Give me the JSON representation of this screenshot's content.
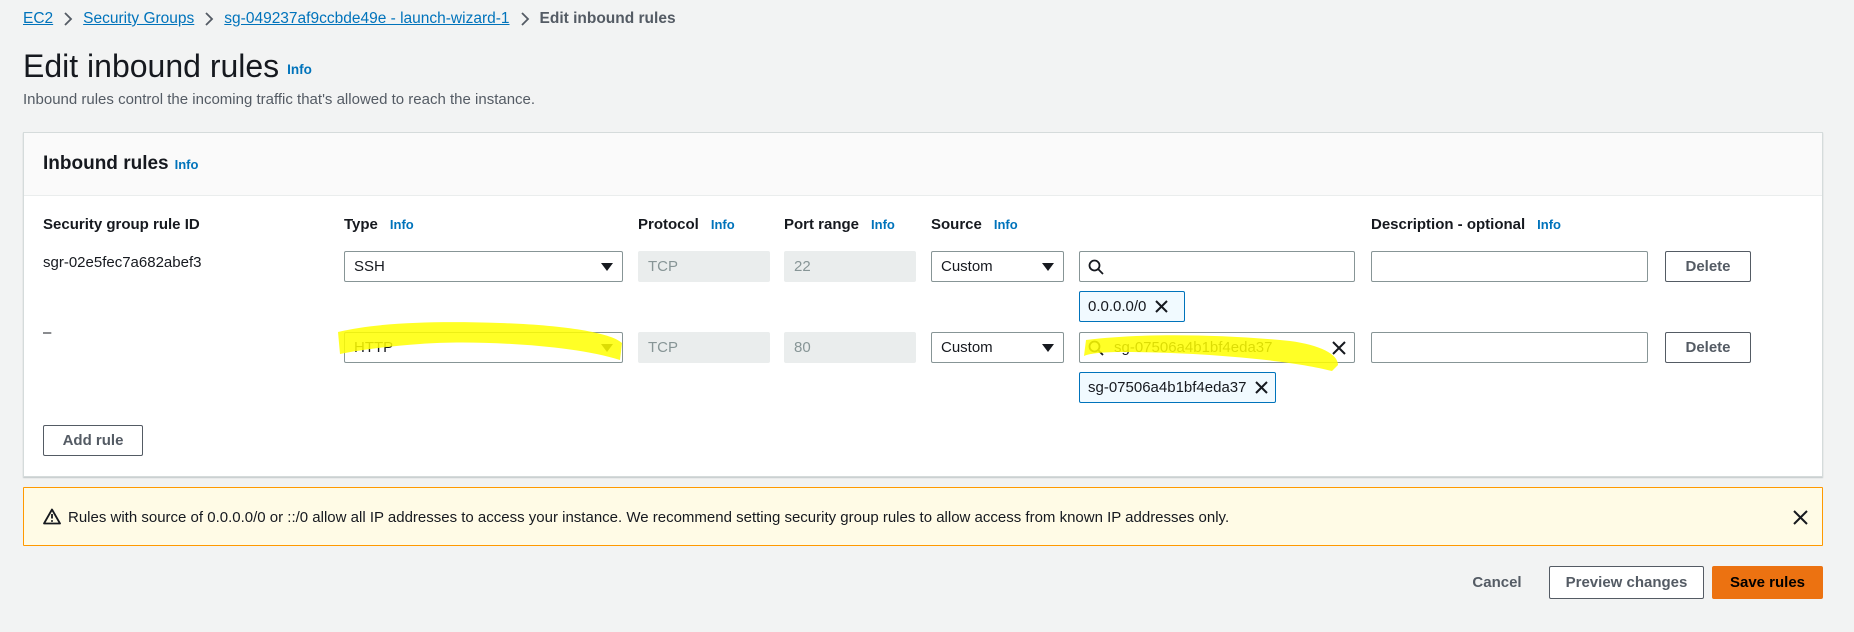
{
  "breadcrumb": {
    "items": [
      "EC2",
      "Security Groups",
      "sg-049237af9ccbde49e - launch-wizard-1"
    ],
    "current": "Edit inbound rules"
  },
  "page": {
    "title": "Edit inbound rules",
    "info": "Info",
    "description": "Inbound rules control the incoming traffic that's allowed to reach the instance."
  },
  "panel": {
    "title": "Inbound rules",
    "info": "Info",
    "columns": {
      "rule_id": "Security group rule ID",
      "type": "Type",
      "protocol": "Protocol",
      "port_range": "Port range",
      "source": "Source",
      "description": "Description - optional",
      "info": "Info"
    },
    "rows": [
      {
        "rule_id": "sgr-02e5fec7a682abef3",
        "type": "SSH",
        "protocol": "TCP",
        "port_range": "22",
        "source": "Custom",
        "search_value": "",
        "token": "0.0.0.0/0",
        "description": "",
        "delete_label": "Delete"
      },
      {
        "rule_id": "–",
        "type": "HTTP",
        "protocol": "TCP",
        "port_range": "80",
        "source": "Custom",
        "search_value": "sg-07506a4b1bf4eda37",
        "token": "sg-07506a4b1bf4eda37",
        "description": "",
        "delete_label": "Delete"
      }
    ],
    "add_rule_label": "Add rule"
  },
  "alert": {
    "text": "Rules with source of 0.0.0.0/0 or ::/0 allow all IP addresses to access your instance. We recommend setting security group rules to allow access from known IP addresses only.",
    "icon": "warning-icon"
  },
  "footer": {
    "cancel_label": "Cancel",
    "preview_label": "Preview changes",
    "save_label": "Save rules"
  },
  "colors": {
    "link": "#0073bb",
    "primary_button": "#ec7211",
    "alert_border": "#ff9900",
    "alert_background": "#fffbe6",
    "highlight": "#ffff00"
  }
}
